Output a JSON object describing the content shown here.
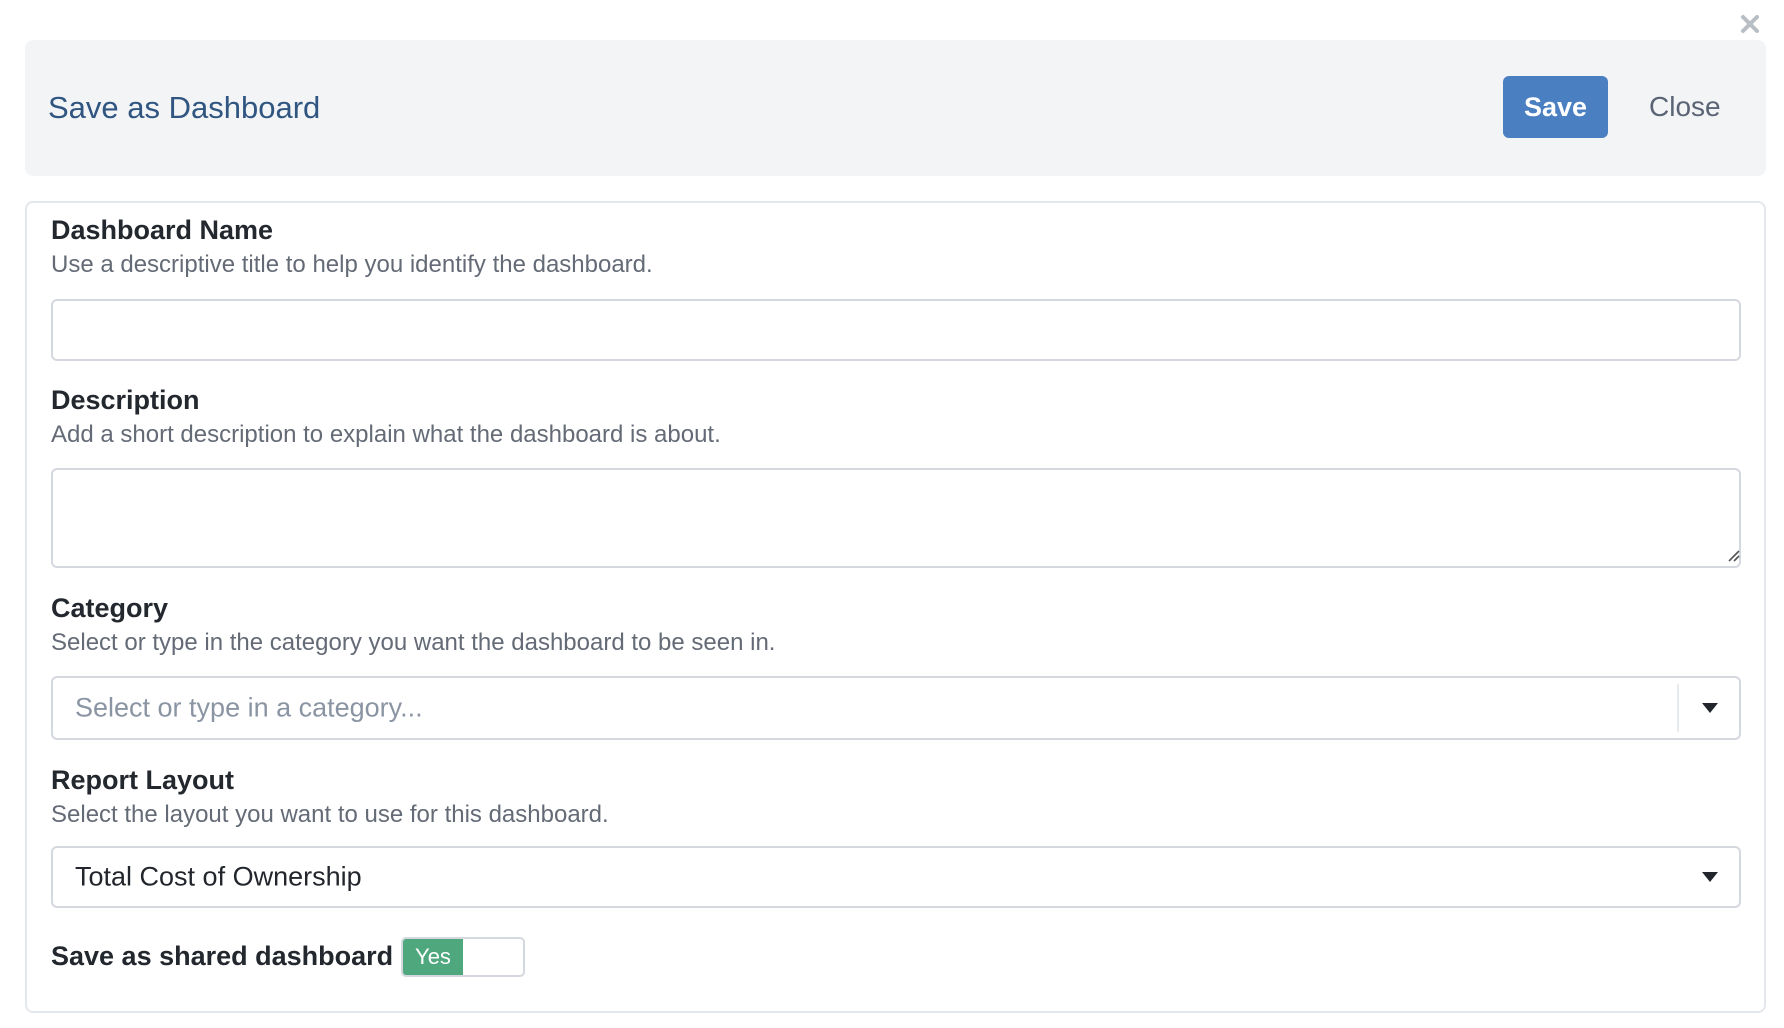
{
  "dialog": {
    "title": "Save as Dashboard",
    "save_label": "Save",
    "close_label": "Close"
  },
  "fields": {
    "name": {
      "label": "Dashboard Name",
      "help": "Use a descriptive title to help you identify the dashboard.",
      "value": "",
      "placeholder": ""
    },
    "description": {
      "label": "Description",
      "help": "Add a short description to explain what the dashboard is about.",
      "value": ""
    },
    "category": {
      "label": "Category",
      "help": "Select or type in the category you want the dashboard to be seen in.",
      "placeholder": "Select or type in a category..."
    },
    "layout": {
      "label": "Report Layout",
      "help": "Select the layout you want to use for this dashboard.",
      "selected": "Total Cost of Ownership"
    },
    "shared": {
      "label": "Save as shared dashboard",
      "toggle_label": "Yes",
      "enabled": true
    }
  },
  "icons": {
    "dismiss": "close-x-icon",
    "dropdown": "caret-down-icon",
    "resize": "resize-grip-icon"
  },
  "colors": {
    "primary": "#4a7fc1",
    "title": "#2f5580",
    "toggle_on": "#4fa87d",
    "header_bg": "#f3f4f6"
  }
}
